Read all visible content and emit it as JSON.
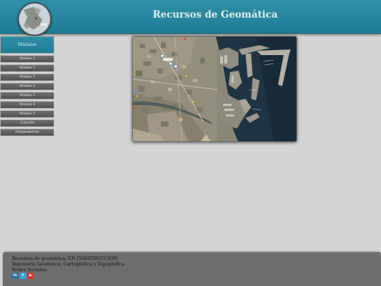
{
  "header": {
    "title": "Recursos de Geomática",
    "logo_icon": "globe-map-icon"
  },
  "sidebar": {
    "heading": "Módulos",
    "items": [
      {
        "label": "Módulo 1"
      },
      {
        "label": "Módulo 2"
      },
      {
        "label": "Módulo 3"
      },
      {
        "label": "Módulo 4"
      },
      {
        "label": "Módulo 5"
      },
      {
        "label": "Módulo 6"
      },
      {
        "label": "Módulo 9"
      },
      {
        "label": "Curs100"
      },
      {
        "label": "Fotogrametría"
      }
    ]
  },
  "main": {
    "map": {
      "kind": "satellite-image",
      "icon": "satellite-map-image"
    }
  },
  "footer": {
    "line1": "Recursos de geomática, EN CONSTRUCCIÓN",
    "line2": "Ingeniería Geodésica, Cartográfica y Topográfica",
    "line3": "Redes Sociales:",
    "social": [
      {
        "label": "in",
        "icon": "linkedin-icon",
        "color": "#2f6fa8"
      },
      {
        "label": "t",
        "icon": "twitter-icon",
        "color": "#3aa3dc"
      },
      {
        "label": "▶",
        "icon": "youtube-icon",
        "color": "#d9342a"
      }
    ]
  },
  "colors": {
    "header": "#2a8aa3",
    "sidebar_heading": "#2a8aa3",
    "sidebar_item": "#606060",
    "background": "#d4d4d4",
    "footer": "#6e6e6e",
    "title_text": "#e6edf2"
  }
}
